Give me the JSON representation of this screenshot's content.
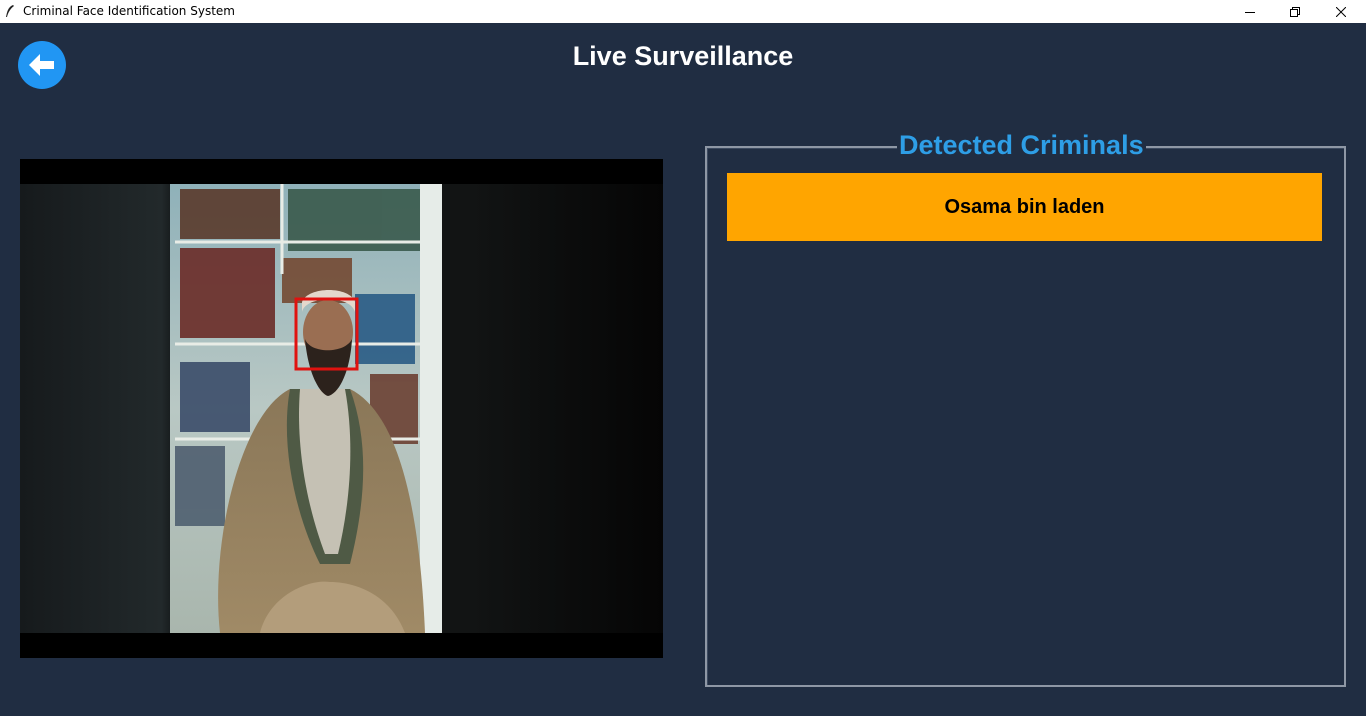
{
  "window": {
    "title": "Criminal Face Identification System",
    "app_icon": "feather-icon",
    "controls": [
      "minimize-icon",
      "restore-icon",
      "close-icon"
    ]
  },
  "header": {
    "title": "Live Surveillance",
    "back_icon": "arrow-left-icon"
  },
  "video": {
    "description_icon": "camera-feed",
    "detection_box_color": "#e0120f"
  },
  "detected": {
    "legend": "Detected Criminals",
    "items": [
      {
        "name": "Osama bin laden"
      }
    ]
  },
  "colors": {
    "background": "#202d42",
    "accent": "#2196f3",
    "legend": "#2e9ee6",
    "item_bg": "#ffa500"
  }
}
